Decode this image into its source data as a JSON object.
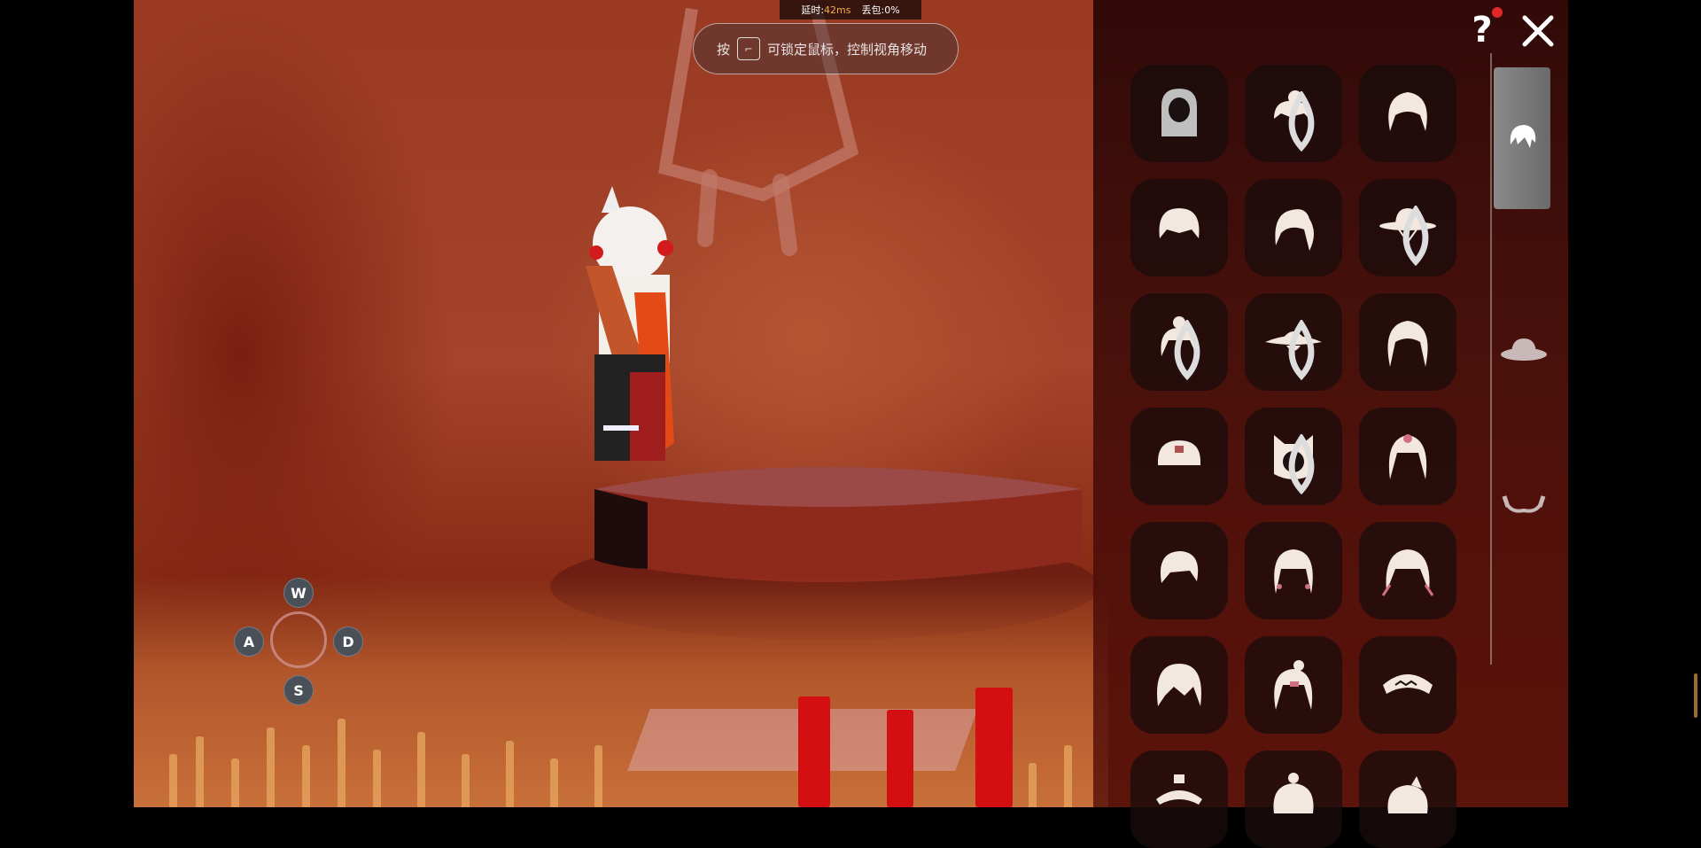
{
  "hud": {
    "latency_label": "延时:",
    "latency_value": "42ms",
    "packet_loss_label": "丢包:",
    "packet_loss_value": "0%",
    "hint_prefix": "按",
    "hint_text": "可锁定鼠标，控制视角移动"
  },
  "controls": {
    "up": "W",
    "left": "A",
    "right": "D",
    "down": "S"
  },
  "panel": {
    "help_label": "?",
    "tabs": [
      {
        "icon": "hair-icon",
        "active": true
      },
      {
        "icon": "hat-icon",
        "active": false
      },
      {
        "icon": "horns-icon",
        "active": false
      }
    ],
    "items": [
      {
        "icon": "hood-icon"
      },
      {
        "icon": "bun-hair-icon",
        "dyeable": true
      },
      {
        "icon": "braided-hair-icon"
      },
      {
        "icon": "short-bob-icon"
      },
      {
        "icon": "ponytail-icon"
      },
      {
        "icon": "wide-brim-hat-icon",
        "dyeable": true
      },
      {
        "icon": "double-bun-hair-icon",
        "dyeable": true
      },
      {
        "icon": "straw-hat-icon",
        "dyeable": true
      },
      {
        "icon": "long-wavy-hair-icon"
      },
      {
        "icon": "cap-hat-icon"
      },
      {
        "icon": "cat-ears-hood-icon",
        "dyeable": true
      },
      {
        "icon": "twin-tail-hair-icon"
      },
      {
        "icon": "bob-hair-icon"
      },
      {
        "icon": "beaded-hair-icon"
      },
      {
        "icon": "feather-hair-icon"
      },
      {
        "icon": "messy-hair-icon"
      },
      {
        "icon": "tied-hair-icon"
      },
      {
        "icon": "headband-icon"
      },
      {
        "icon": "ornament-hat-icon"
      },
      {
        "icon": "top-bun-icon"
      },
      {
        "icon": "side-ponytail-icon"
      }
    ]
  },
  "colors": {
    "scene_base": "#9a3a22",
    "panel_bg": "#2a0808",
    "candle": "#d30f12",
    "key_bg": "#4a5058",
    "help_dot": "#e02828"
  }
}
